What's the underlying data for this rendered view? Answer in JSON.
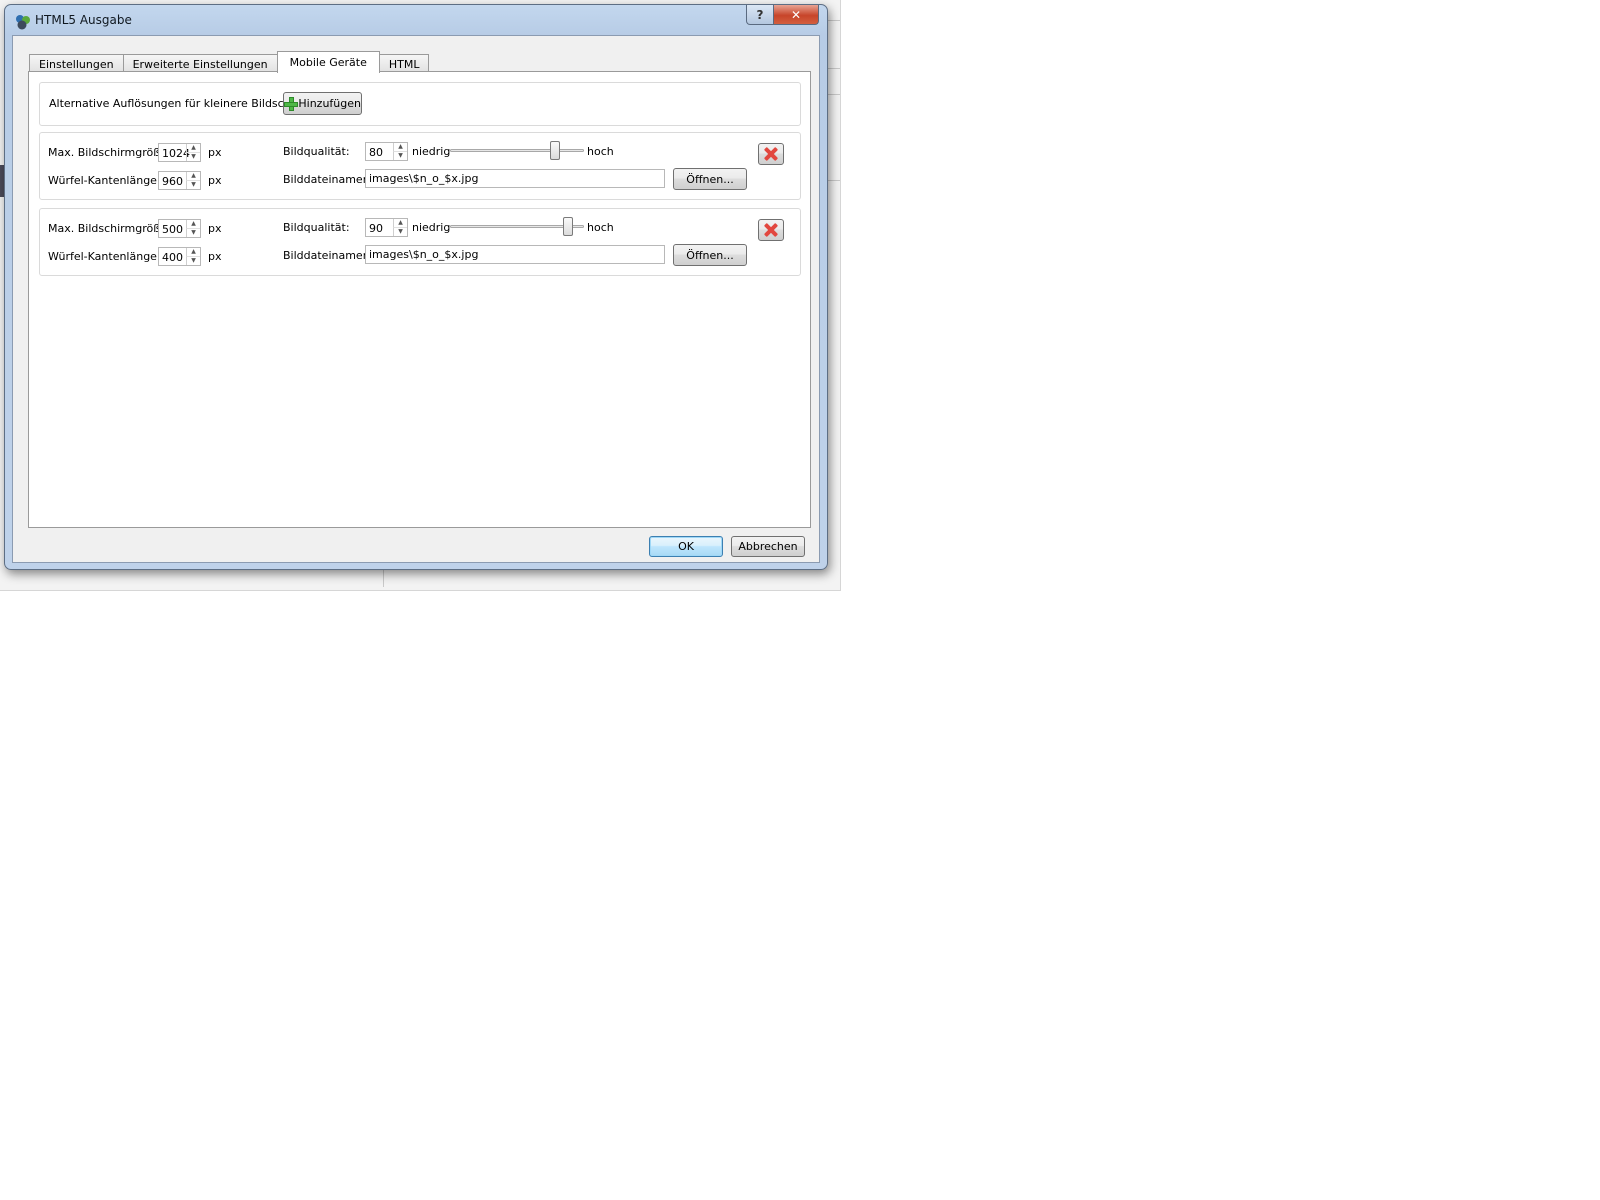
{
  "window": {
    "title": "HTML5 Ausgabe",
    "help_label": "?",
    "close_label": "✕"
  },
  "tabs": [
    {
      "label": "Einstellungen",
      "active": false
    },
    {
      "label": "Erweiterte Einstellungen",
      "active": false
    },
    {
      "label": "Mobile Geräte",
      "active": true
    },
    {
      "label": "HTML",
      "active": false
    }
  ],
  "alt": {
    "label": "Alternative Auflösungen für kleinere Bildschirme:",
    "add_label": "Hinzufügen"
  },
  "labels": {
    "max_screen": "Max. Bildschirmgröße:",
    "cube_edge": "Würfel-Kantenlänge:",
    "unit": "px",
    "quality": "Bildqualität:",
    "low": "niedrig",
    "high": "hoch",
    "filename": "Bilddateinamen:",
    "open": "Öffnen...",
    "spin_up": "▲",
    "spin_down": "▼"
  },
  "rows": [
    {
      "max_screen": "1024",
      "cube_edge": "960",
      "quality": "80",
      "quality_fraction": 0.78,
      "filename": "images\\$n_o_$x.jpg"
    },
    {
      "max_screen": "500",
      "cube_edge": "400",
      "quality": "90",
      "quality_fraction": 0.88,
      "filename": "images\\$n_o_$x.jpg"
    }
  ],
  "footer": {
    "ok_label": "OK",
    "cancel_label": "Abbrechen"
  }
}
